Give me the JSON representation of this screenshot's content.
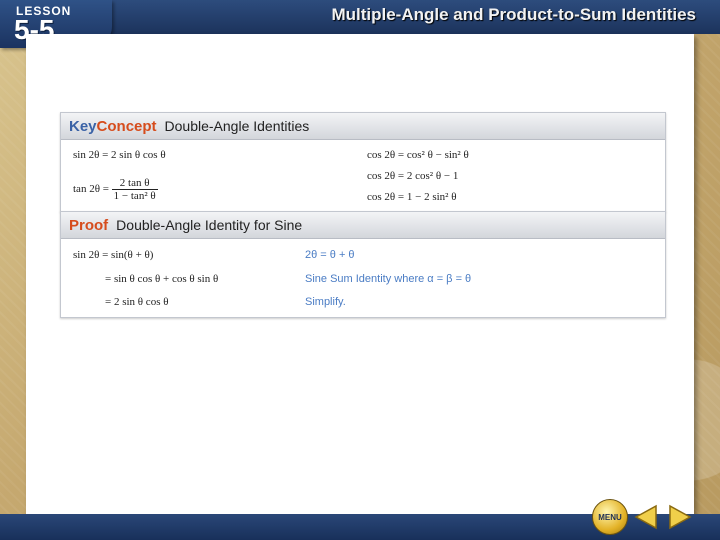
{
  "header": {
    "lesson_word": "LESSON",
    "lesson_number": "5-5",
    "title": "Multiple-Angle and Product-to-Sum Identities"
  },
  "key_concept": {
    "label_key": "Key",
    "label_concept": "Concept",
    "heading": "Double-Angle Identities",
    "left": {
      "sin_identity": "sin 2θ = 2 sin θ cos θ",
      "tan_lhs": "tan 2θ =",
      "tan_num": "2 tan θ",
      "tan_den": "1 − tan² θ"
    },
    "right": [
      "cos 2θ = cos² θ − sin² θ",
      "cos 2θ = 2 cos² θ − 1",
      "cos 2θ = 1 − 2 sin² θ"
    ]
  },
  "proof": {
    "label": "Proof",
    "heading": "Double-Angle Identity for Sine",
    "steps": [
      {
        "expr": "sin 2θ = sin(θ + θ)",
        "reason": "2θ = θ + θ"
      },
      {
        "expr": "= sin θ cos θ + cos θ sin θ",
        "reason": "Sine Sum Identity where α = β = θ"
      },
      {
        "expr": "= 2 sin θ cos θ",
        "reason": "Simplify."
      }
    ]
  },
  "navigation": {
    "menu_label": "MENU"
  },
  "colors": {
    "header_blue": "#1c335c",
    "key_orange": "#d64c1c",
    "reason_blue": "#4a7cc4"
  }
}
